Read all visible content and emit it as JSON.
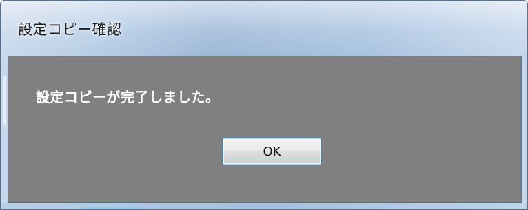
{
  "dialog": {
    "title": "設定コピー確認",
    "message": "設定コピーが完了しました。",
    "ok_label": "OK"
  },
  "colors": {
    "client_background": "#808080",
    "message_text": "#ffffff",
    "ok_border": "#3c7fb1"
  }
}
